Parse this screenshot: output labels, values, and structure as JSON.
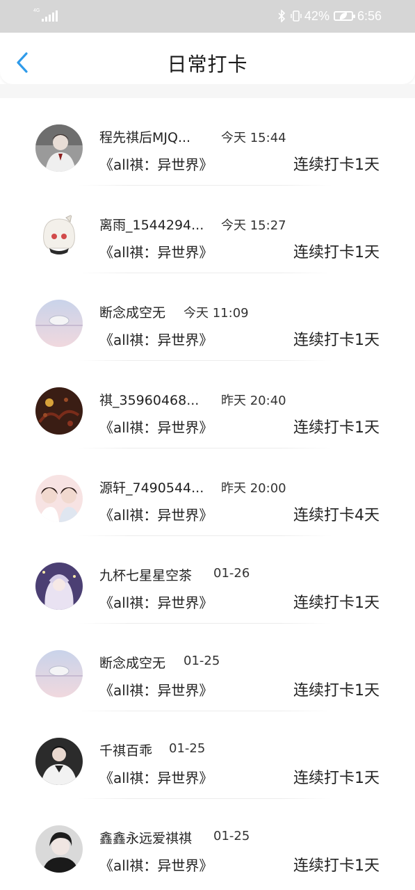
{
  "status_bar": {
    "network": "4G",
    "battery": "42%",
    "time": "6:56",
    "icons": [
      "signal-icon",
      "bluetooth-icon",
      "vibrate-icon",
      "battery-saver-icon"
    ]
  },
  "header": {
    "title": "日常打卡",
    "back_icon": "chevron-left-icon",
    "accent_color": "#2f9bea"
  },
  "items": [
    {
      "name": "程先祺后MJQ...",
      "time": "今天 15:44",
      "book": "《all祺：异世界》",
      "streak": "连续打卡1天"
    },
    {
      "name": "离雨_1544294...",
      "time": "今天 15:27",
      "book": "《all祺：异世界》",
      "streak": "连续打卡1天"
    },
    {
      "name": "断念成空无",
      "time": "今天 11:09",
      "book": "《all祺：异世界》",
      "streak": "连续打卡1天"
    },
    {
      "name": "祺_35960468...",
      "time": "昨天 20:40",
      "book": "《all祺：异世界》",
      "streak": "连续打卡1天"
    },
    {
      "name": "源轩_7490544...",
      "time": "昨天 20:00",
      "book": "《all祺：异世界》",
      "streak": "连续打卡4天"
    },
    {
      "name": "九杯七星星空茶",
      "time": "01-26",
      "book": "《all祺：异世界》",
      "streak": "连续打卡1天"
    },
    {
      "name": "断念成空无",
      "time": "01-25",
      "book": "《all祺：异世界》",
      "streak": "连续打卡1天"
    },
    {
      "name": "千祺百乖",
      "time": "01-25",
      "book": "《all祺：异世界》",
      "streak": "连续打卡1天"
    },
    {
      "name": "鑫鑫永远爱祺祺",
      "time": "01-25",
      "book": "《all祺：异世界》",
      "streak": "连续打卡1天"
    }
  ]
}
